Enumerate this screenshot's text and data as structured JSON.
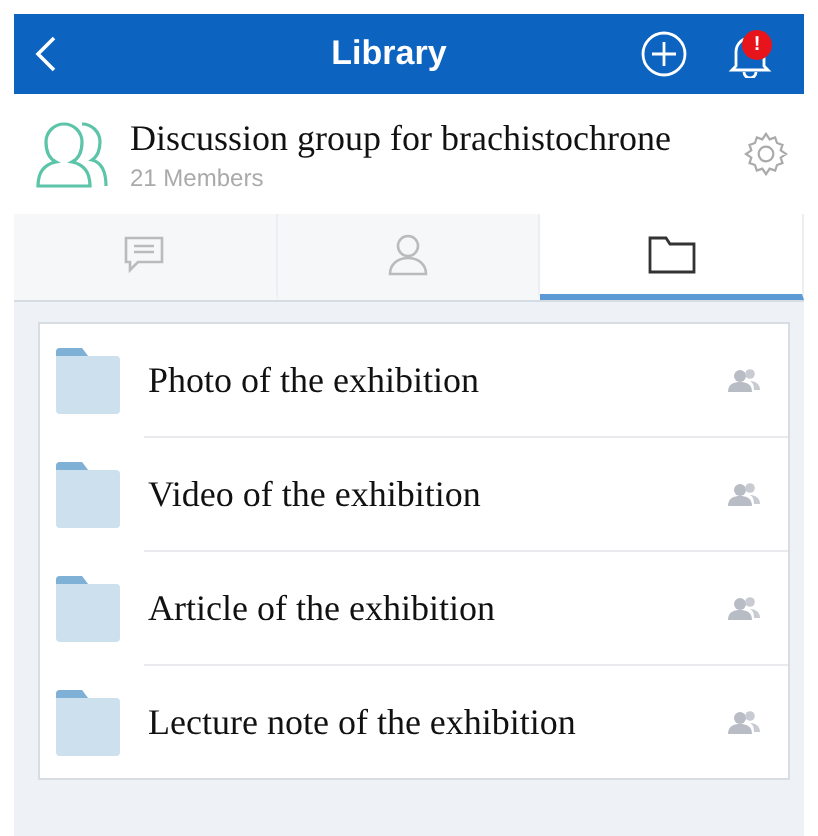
{
  "header": {
    "title": "Library",
    "badge": "!"
  },
  "group": {
    "name": "Discussion group for brachistochrone",
    "members": "21 Members"
  },
  "tabs": [
    {
      "kind": "chat",
      "selected": false
    },
    {
      "kind": "contacts",
      "selected": false
    },
    {
      "kind": "folder",
      "selected": true
    }
  ],
  "folders": [
    {
      "name": "Photo of the exhibition",
      "shared": true
    },
    {
      "name": "Video of the exhibition",
      "shared": true
    },
    {
      "name": "Article of the exhibition",
      "shared": true
    },
    {
      "name": "Lecture note of the exhibition",
      "shared": true
    }
  ]
}
